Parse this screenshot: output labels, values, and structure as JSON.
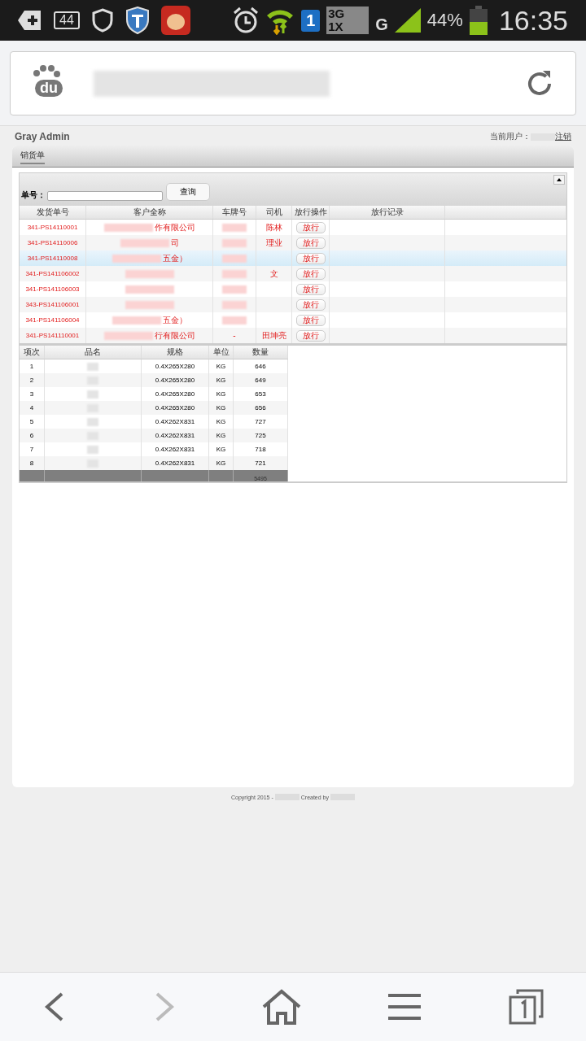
{
  "status_bar": {
    "notification_count": "44",
    "sim": "1",
    "network_top": "3G",
    "network_bottom": "1X",
    "network_type": "G",
    "battery": "44%",
    "time": "16:35"
  },
  "browser": {
    "logo_text": "du"
  },
  "app": {
    "title": "Gray Admin",
    "user_label": "当前用户：",
    "logout": "注销"
  },
  "tabs": [
    {
      "label": "销货单",
      "selected": true
    }
  ],
  "search": {
    "label": "单号：",
    "button": "查询"
  },
  "orders": {
    "columns": [
      "发货单号",
      "客户全称",
      "车牌号",
      "司机",
      "放行操作",
      "放行记录"
    ],
    "rows": [
      {
        "order_no": "341-PS14110001",
        "customer": "作有限公司",
        "driver": "陈林",
        "action": "放行",
        "selected": false
      },
      {
        "order_no": "341-PS14110006",
        "customer": "司",
        "driver": "理业",
        "action": "放行",
        "selected": false
      },
      {
        "order_no": "341-PS14110008",
        "customer": "五金）",
        "action": "放行",
        "selected": true
      },
      {
        "order_no": "341-PS141106002",
        "driver": "文",
        "action": "放行",
        "selected": false
      },
      {
        "order_no": "341-PS141106003",
        "action": "放行",
        "selected": false
      },
      {
        "order_no": "343-PS141106001",
        "action": "放行",
        "selected": false
      },
      {
        "order_no": "341-PS141106004",
        "customer": "五金）",
        "action": "放行",
        "selected": false
      },
      {
        "order_no": "341-PS141110001",
        "customer": "行有限公司",
        "plate": "-",
        "driver": "田坤亮",
        "action": "放行",
        "selected": false
      }
    ]
  },
  "items": {
    "columns": [
      "项次",
      "品名",
      "规格",
      "单位",
      "数量"
    ],
    "rows": [
      {
        "no": "1",
        "spec": "0.4X265X280",
        "unit": "KG",
        "qty": "646"
      },
      {
        "no": "2",
        "spec": "0.4X265X280",
        "unit": "KG",
        "qty": "649"
      },
      {
        "no": "3",
        "spec": "0.4X265X280",
        "unit": "KG",
        "qty": "653"
      },
      {
        "no": "4",
        "spec": "0.4X265X280",
        "unit": "KG",
        "qty": "656"
      },
      {
        "no": "5",
        "spec": "0.4X262X831",
        "unit": "KG",
        "qty": "727"
      },
      {
        "no": "6",
        "spec": "0.4X262X831",
        "unit": "KG",
        "qty": "725"
      },
      {
        "no": "7",
        "spec": "0.4X262X831",
        "unit": "KG",
        "qty": "718"
      },
      {
        "no": "8",
        "spec": "0.4X262X831",
        "unit": "KG",
        "qty": "721"
      }
    ],
    "total": "5495"
  },
  "footer": {
    "copyright": "Copyright 2015 -",
    "created": "Created by"
  }
}
